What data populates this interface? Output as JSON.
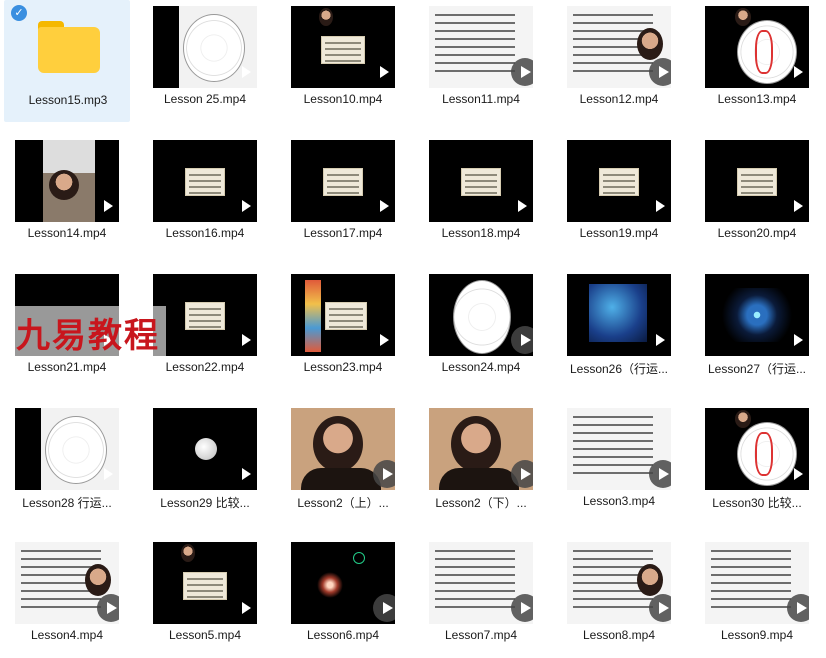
{
  "files": [
    {
      "name": "Lesson15.mp3",
      "kind": "folder",
      "selected": true
    },
    {
      "name": "Lesson 25.mp4",
      "kind": "wheel"
    },
    {
      "name": "Lesson10.mp4",
      "kind": "doc-inset"
    },
    {
      "name": "Lesson11.mp4",
      "kind": "page-circle"
    },
    {
      "name": "Lesson12.mp4",
      "kind": "page-face"
    },
    {
      "name": "Lesson13.mp4",
      "kind": "wheel-dark"
    },
    {
      "name": "Lesson14.mp4",
      "kind": "room"
    },
    {
      "name": "Lesson16.mp4",
      "kind": "doc"
    },
    {
      "name": "Lesson17.mp4",
      "kind": "doc"
    },
    {
      "name": "Lesson18.mp4",
      "kind": "doc"
    },
    {
      "name": "Lesson19.mp4",
      "kind": "doc"
    },
    {
      "name": "Lesson20.mp4",
      "kind": "doc"
    },
    {
      "name": "Lesson21.mp4",
      "kind": "blank"
    },
    {
      "name": "Lesson22.mp4",
      "kind": "doc"
    },
    {
      "name": "Lesson23.mp4",
      "kind": "doc-strip"
    },
    {
      "name": "Lesson24.mp4",
      "kind": "wheel-circle"
    },
    {
      "name": "Lesson26（行运...",
      "kind": "texture-blue"
    },
    {
      "name": "Lesson27（行运...",
      "kind": "kaleido"
    },
    {
      "name": "Lesson28 行运...",
      "kind": "wheel"
    },
    {
      "name": "Lesson29 比较...",
      "kind": "moon"
    },
    {
      "name": "Lesson2（上）...",
      "kind": "person"
    },
    {
      "name": "Lesson2（下）...",
      "kind": "person"
    },
    {
      "name": "Lesson3.mp4",
      "kind": "page-circle"
    },
    {
      "name": "Lesson30 比较...",
      "kind": "wheel-dark"
    },
    {
      "name": "Lesson4.mp4",
      "kind": "page-face"
    },
    {
      "name": "Lesson5.mp4",
      "kind": "doc-inset"
    },
    {
      "name": "Lesson6.mp4",
      "kind": "dark-glow"
    },
    {
      "name": "Lesson7.mp4",
      "kind": "page-circle"
    },
    {
      "name": "Lesson8.mp4",
      "kind": "page-face"
    },
    {
      "name": "Lesson9.mp4",
      "kind": "page-circle"
    }
  ],
  "watermark": "九易教程",
  "icons": {
    "play": "play-icon",
    "folder": "folder-icon",
    "check": "check-icon"
  }
}
